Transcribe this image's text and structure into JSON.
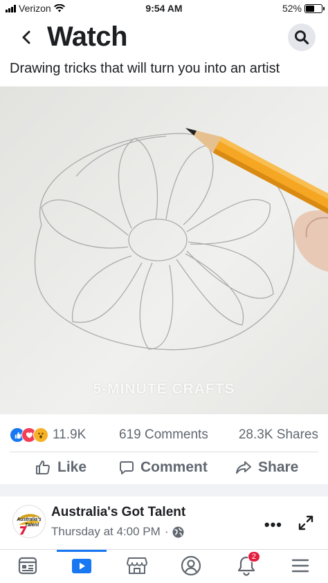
{
  "status_bar": {
    "carrier": "Verizon",
    "time": "9:54 AM",
    "battery": "52%",
    "battery_level": 0.52
  },
  "header": {
    "title": "Watch"
  },
  "video": {
    "caption": "Drawing tricks that will turn you into an artist",
    "watermark": "5-MINUTE CRAFTS"
  },
  "stats": {
    "reactions_count": "11.9K",
    "comments": "619 Comments",
    "shares": "28.3K Shares"
  },
  "actions": {
    "like": "Like",
    "comment": "Comment",
    "share": "Share"
  },
  "post": {
    "page_name": "Australia's Got Talent",
    "time": "Thursday at 4:00 PM",
    "separator": "·",
    "more": "•••"
  },
  "tab_bar": {
    "notifications_badge": "2",
    "active_tab": "watch"
  },
  "colors": {
    "accent": "#1877f2",
    "badge": "#e41e3f",
    "pencil": "#f5a623"
  }
}
